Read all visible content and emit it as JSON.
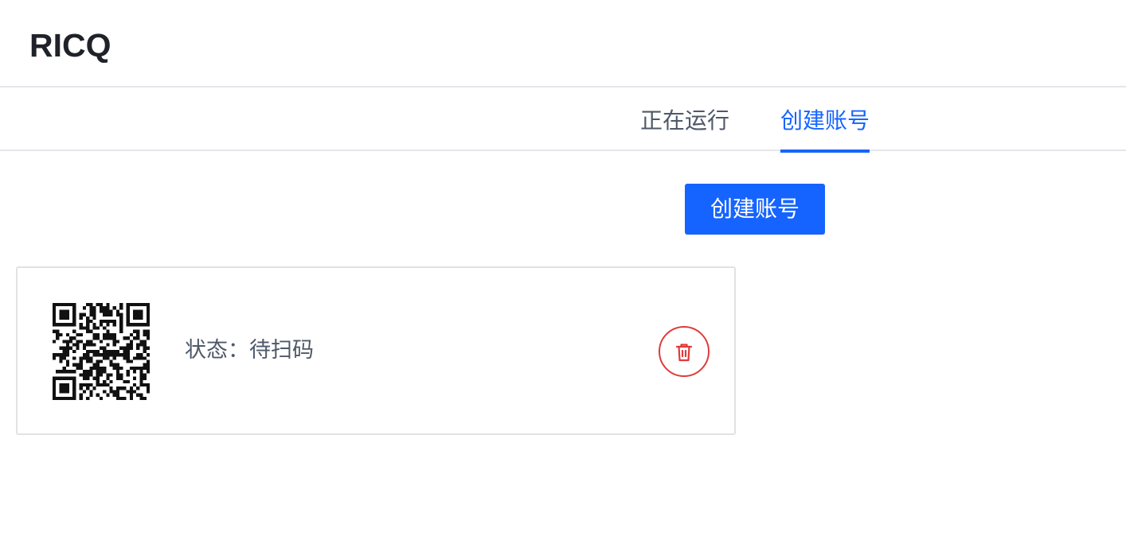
{
  "header": {
    "title": "RICQ"
  },
  "tabs": [
    {
      "label": "正在运行",
      "active": false
    },
    {
      "label": "创建账号",
      "active": true
    }
  ],
  "toolbar": {
    "create_label": "创建账号"
  },
  "account_card": {
    "qr_icon": "qr-code",
    "status_label": "状态：",
    "status_value": "待扫码",
    "delete_icon": "trash-icon"
  },
  "colors": {
    "accent": "#1664ff",
    "danger": "#e03a3a",
    "text_secondary": "#4e5969"
  }
}
